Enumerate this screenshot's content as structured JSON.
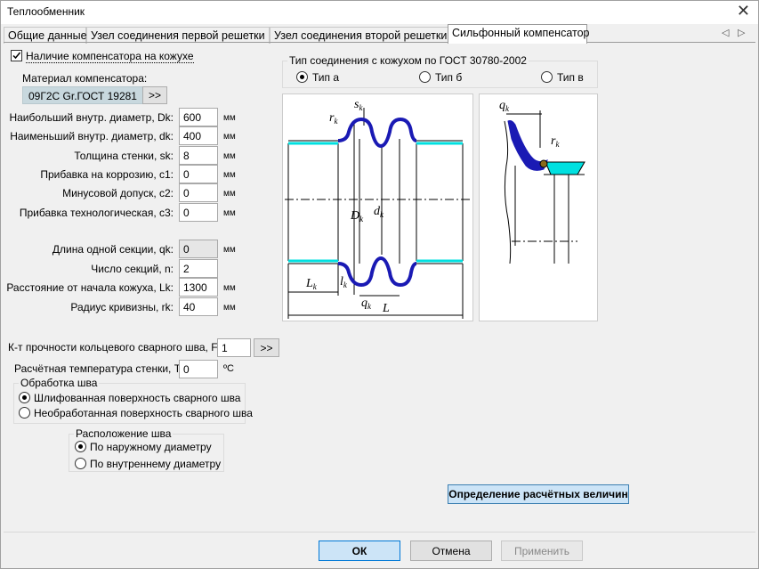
{
  "window": {
    "title": "Теплообменник"
  },
  "tabs": [
    {
      "label": "Общие данные"
    },
    {
      "label": "Узел соединения первой решетки"
    },
    {
      "label": "Узел соединения второй решетки"
    },
    {
      "label": "Сильфонный компенсатор"
    }
  ],
  "compensator": {
    "checkbox_label": "Наличие компенсатора на кожухе",
    "checked": true,
    "material_label": "Материал компенсатора:",
    "material_value": "09Г2С Gr.ГОСТ 19281",
    "material_button": ">>"
  },
  "params": [
    {
      "label": "Наибольший внутр. диаметр, Dk:",
      "value": "600",
      "unit": "мм"
    },
    {
      "label": "Наименьший внутр. диаметр, dk:",
      "value": "400",
      "unit": "мм"
    },
    {
      "label": "Толщина стенки, sk:",
      "value": "8",
      "unit": "мм"
    },
    {
      "label": "Прибавка на коррозию, c1:",
      "value": "0",
      "unit": "мм"
    },
    {
      "label": "Минусовой допуск, c2:",
      "value": "0",
      "unit": "мм"
    },
    {
      "label": "Прибавка технологическая, c3:",
      "value": "0",
      "unit": "мм"
    }
  ],
  "params2": [
    {
      "label": "Длина одной секции, qk:",
      "value": "0",
      "unit": "мм",
      "readonly": true
    },
    {
      "label": "Число секций, n:",
      "value": "2",
      "unit": ""
    },
    {
      "label": "Расстояние от начала кожуха, Lk:",
      "value": "1300",
      "unit": "мм"
    },
    {
      "label": "Радиус кривизны, rk:",
      "value": "40",
      "unit": "мм"
    }
  ],
  "weld": {
    "fit_label": "К-т прочности кольцевого сварного шва, Fit:",
    "fit_value": "1",
    "fit_button": ">>",
    "temp_label": "Расчётная температура стенки, T:",
    "temp_value": "0",
    "temp_unit": "ºС",
    "treatment_label": "Обработка шва",
    "treatment_options": [
      "Шлифованная поверхность сварного шва",
      "Необработанная поверхность сварного шва"
    ],
    "treatment_selected": 0,
    "location_label": "Расположение шва",
    "location_options": [
      "По наружному диаметру",
      "По внутреннему диаметру"
    ],
    "location_selected": 0
  },
  "connection": {
    "label": "Тип соединения с кожухом по ГОСТ 30780-2002",
    "options": [
      "Тип а",
      "Тип б",
      "Тип в"
    ],
    "selected": 0
  },
  "drawing_labels": {
    "rk": "r",
    "sk": "s",
    "Dk": "D",
    "dk": "d",
    "Lk": "L",
    "lk": "l",
    "qk": "q",
    "L": "L",
    "sub": "k"
  },
  "colors": {
    "bellows": "#1a1ab4",
    "liner": "#00e0e0"
  },
  "actions": {
    "calc_button": "Определение расчётных величин",
    "ok": "ОК",
    "cancel": "Отмена",
    "apply": "Применить"
  }
}
